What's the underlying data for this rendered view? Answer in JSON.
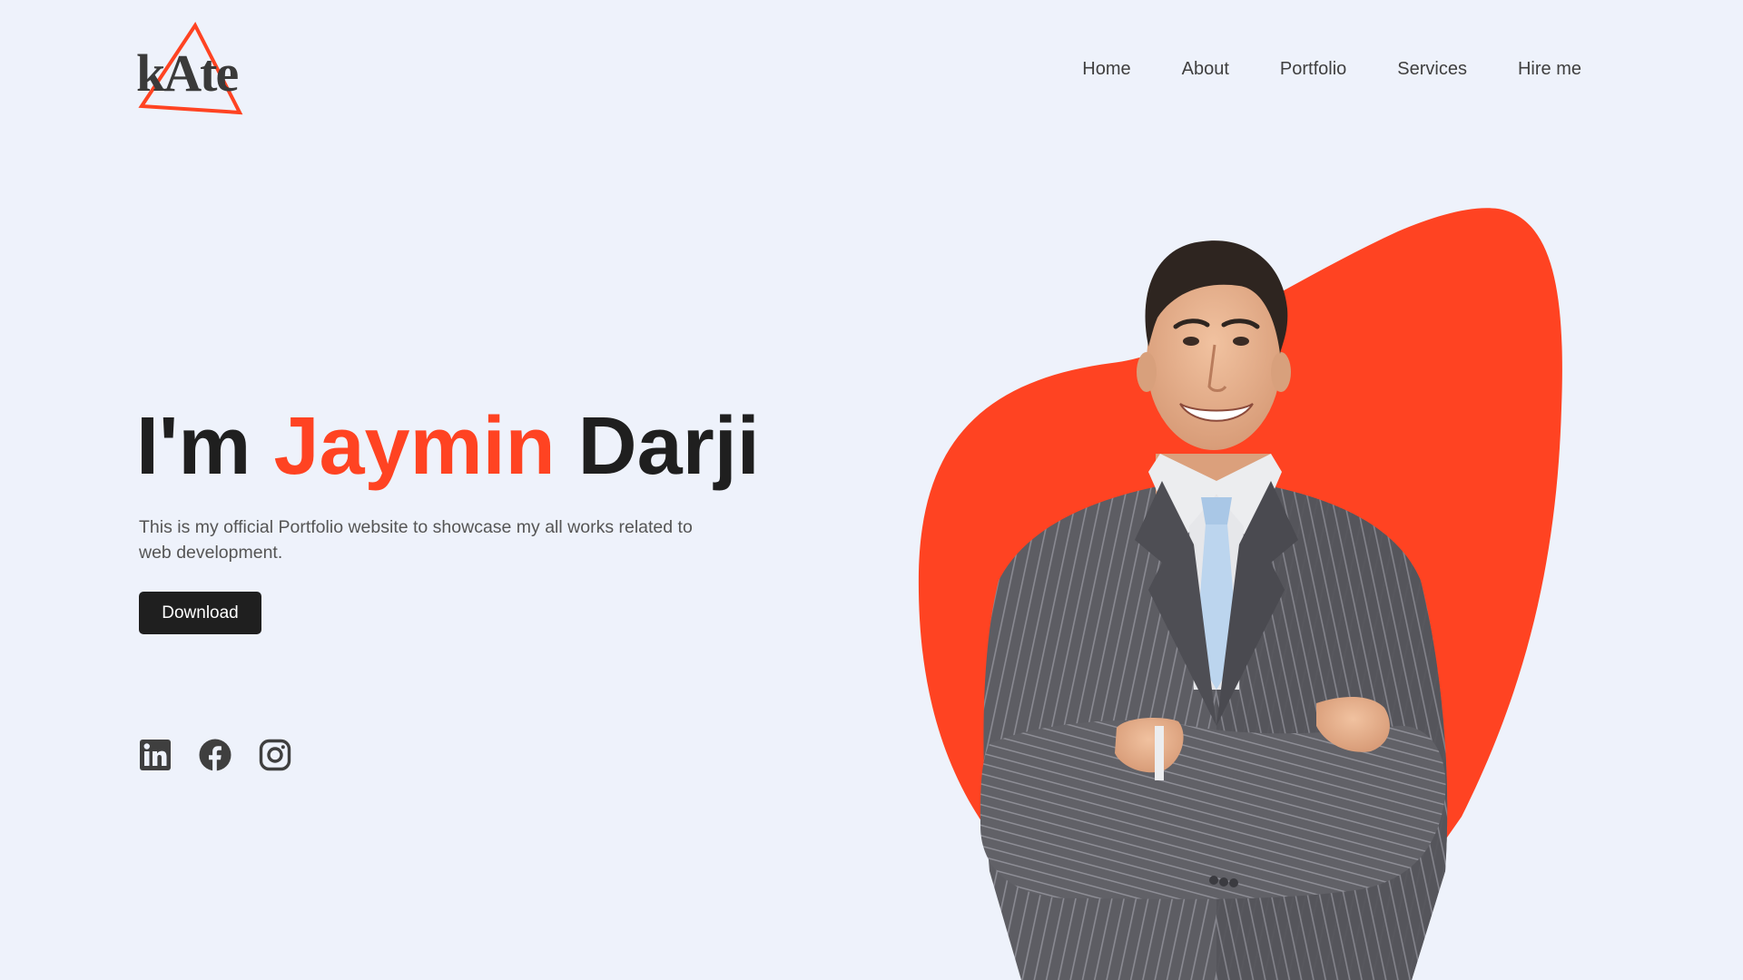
{
  "brand": {
    "logo_text": "kAte",
    "accent_color": "#ff4322",
    "dark_color": "#1f1f1f"
  },
  "nav": {
    "items": [
      {
        "label": "Home"
      },
      {
        "label": "About"
      },
      {
        "label": "Portfolio"
      },
      {
        "label": "Services"
      },
      {
        "label": "Hire me"
      }
    ]
  },
  "hero": {
    "greeting": "I'm",
    "first_name": "Jaymin",
    "last_name": "Darji",
    "description": "This is my official Portfolio website to showcase my all works related to web development.",
    "button_label": "Download"
  },
  "socials": [
    {
      "icon": "linkedin-icon"
    },
    {
      "icon": "facebook-icon"
    },
    {
      "icon": "instagram-icon"
    }
  ],
  "portrait": {
    "subject": "smiling man in pinstripe suit with light blue tie, arms crossed",
    "blob_color": "#ff4322"
  }
}
